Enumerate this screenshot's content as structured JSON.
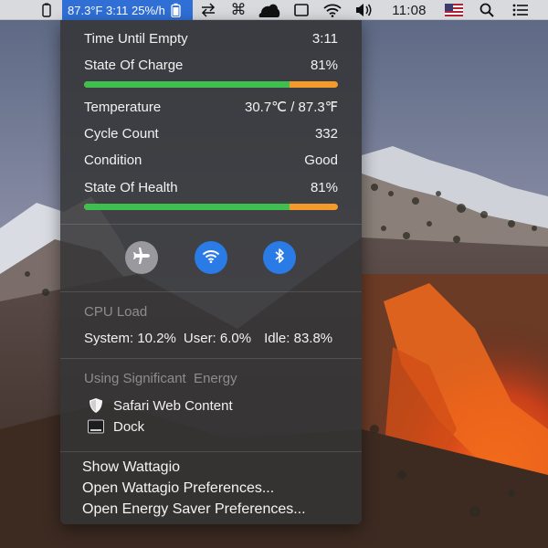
{
  "menubar": {
    "wattagio_status": "87.3°F 3:11 25%/h",
    "clock": "11:08",
    "icons": [
      "app-icon",
      "battery-icon",
      "transfer-icon",
      "command-icon",
      "cloud-icon",
      "display-icon",
      "wifi-icon",
      "volume-icon",
      "us-flag-icon",
      "spotlight-search-icon",
      "notification-center-icon"
    ]
  },
  "battery": {
    "time_until_empty": {
      "label": "Time Until Empty",
      "value": "3:11"
    },
    "state_of_charge": {
      "label": "State Of Charge",
      "value": "81%",
      "fill": 0.81
    },
    "temperature": {
      "label": "Temperature",
      "value": "30.7℃ / 87.3℉"
    },
    "cycle_count": {
      "label": "Cycle Count",
      "value": "332"
    },
    "condition": {
      "label": "Condition",
      "value": "Good"
    },
    "state_of_health": {
      "label": "State Of Health",
      "value": "81%",
      "fill": 0.81
    }
  },
  "toggles": [
    {
      "name": "airplane-mode",
      "active": false,
      "color": "#9a9a9e"
    },
    {
      "name": "wifi",
      "active": true,
      "color": "#2a7be6"
    },
    {
      "name": "bluetooth",
      "active": true,
      "color": "#2a7be6"
    }
  ],
  "cpu": {
    "header": "CPU Load",
    "system": "System: 10.2%",
    "user": "User: 6.0%",
    "idle": "Idle: 83.8%"
  },
  "energy": {
    "header": "Using Significant  Energy",
    "apps": [
      "Safari Web Content",
      "Dock"
    ]
  },
  "commands": {
    "show": "Show Wattagio",
    "prefs": "Open Wattagio Preferences...",
    "energy_saver": "Open Energy Saver Preferences..."
  },
  "colors": {
    "bar_good": "#3fbf4f",
    "bar_remaining": "#f39a2a",
    "highlight": "#2f6fd6",
    "toggle_active": "#2a7be6"
  }
}
